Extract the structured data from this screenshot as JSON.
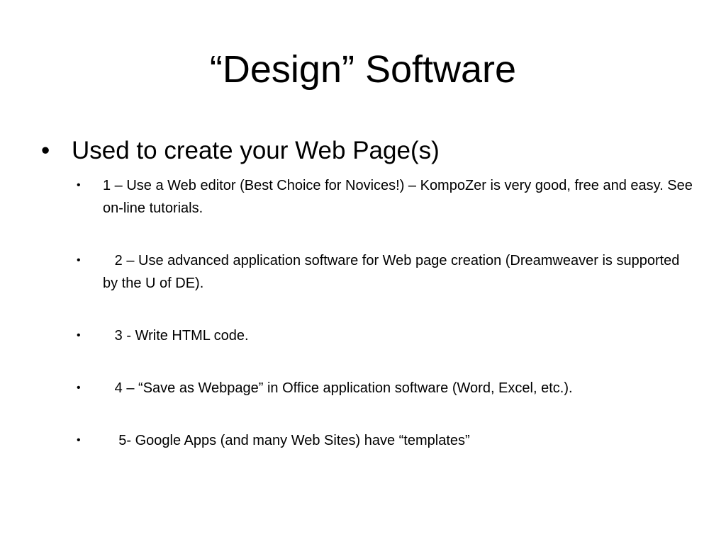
{
  "slide": {
    "title": "“Design” Software",
    "main_bullet": {
      "marker": "•",
      "text": "Used to create your Web Page(s)"
    },
    "sub_bullets": [
      {
        "marker": "•",
        "text": "1 – Use a Web editor (Best Choice for Novices!) – KompoZer is very good, free and easy. See on-line tutorials."
      },
      {
        "marker": "•",
        "text": "   2 – Use advanced application software for Web page creation (Dreamweaver is supported by the U of DE)."
      },
      {
        "marker": "•",
        "text": "   3 - Write HTML code."
      },
      {
        "marker": "•",
        "text": "   4 – “Save as Webpage” in Office application software (Word, Excel, etc.)."
      },
      {
        "marker": "•",
        "text": "    5- Google Apps (and many Web Sites) have “templates”"
      }
    ]
  }
}
